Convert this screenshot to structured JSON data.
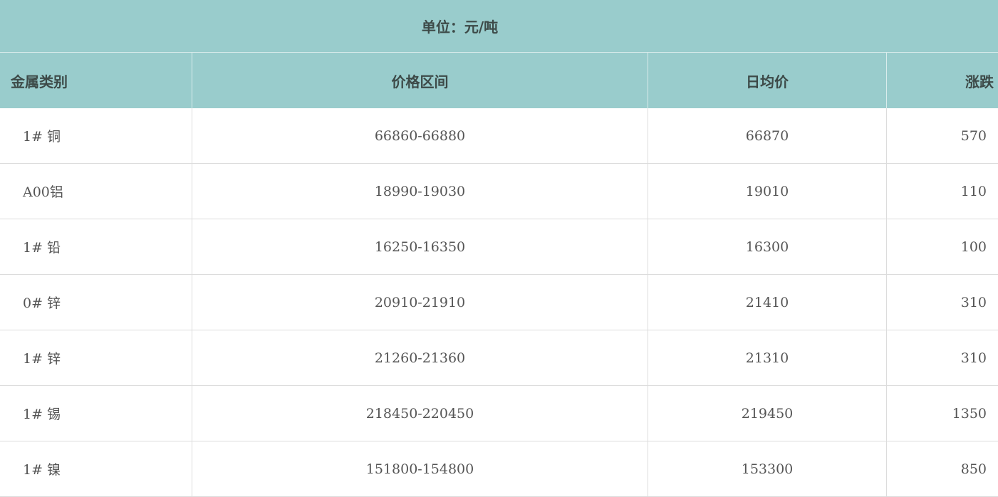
{
  "unit_label": "单位：元/吨",
  "columns": {
    "metal": "金属类别",
    "range": "价格区间",
    "avg": "日均价",
    "change": "涨跌"
  },
  "rows": [
    {
      "metal": "1# 铜",
      "range": "66860-66880",
      "avg": "66870",
      "change": "570"
    },
    {
      "metal": "A00铝",
      "range": "18990-19030",
      "avg": "19010",
      "change": "110"
    },
    {
      "metal": "1# 铅",
      "range": "16250-16350",
      "avg": "16300",
      "change": "100"
    },
    {
      "metal": "0# 锌",
      "range": "20910-21910",
      "avg": "21410",
      "change": "310"
    },
    {
      "metal": "1# 锌",
      "range": "21260-21360",
      "avg": "21310",
      "change": "310"
    },
    {
      "metal": "1# 锡",
      "range": "218450-220450",
      "avg": "219450",
      "change": "1350"
    },
    {
      "metal": "1# 镍",
      "range": "151800-154800",
      "avg": "153300",
      "change": "850"
    }
  ],
  "colors": {
    "header_bg": "#99cccc",
    "header_text": "#3d4a48",
    "cell_text": "#555555",
    "grid": "#dcdcdc"
  }
}
